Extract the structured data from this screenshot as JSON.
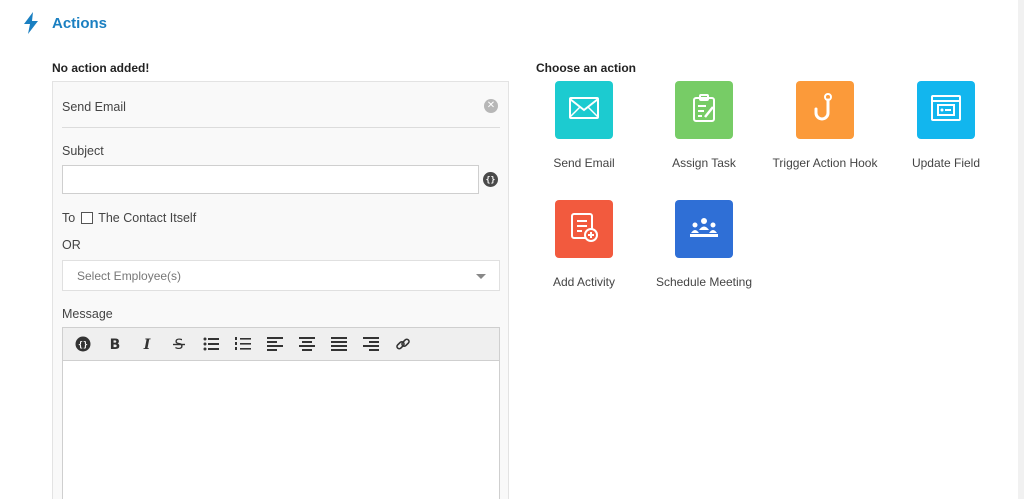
{
  "header": {
    "title": "Actions",
    "icon": "lightning-bolt-icon",
    "accent": "#1a7fc1"
  },
  "left": {
    "heading": "No action added!",
    "panel": {
      "title": "Send Email",
      "subject_label": "Subject",
      "subject_value": "",
      "to_label": "To",
      "to_option": "The Contact Itself",
      "or_label": "OR",
      "employee_placeholder": "Select Employee(s)",
      "message_label": "Message",
      "placeholder_glyph": "{}"
    }
  },
  "right": {
    "heading": "Choose an action",
    "actions": [
      {
        "label": "Send Email",
        "icon": "envelope-icon",
        "color": "#1ccbd0"
      },
      {
        "label": "Assign Task",
        "icon": "clipboard-task-icon",
        "color": "#77cc66"
      },
      {
        "label": "Trigger Action Hook",
        "icon": "hook-icon",
        "color": "#fb9a3a"
      },
      {
        "label": "Update Field",
        "icon": "form-field-icon",
        "color": "#12b6ee"
      },
      {
        "label": "Add Activity",
        "icon": "activity-list-icon",
        "color": "#f25a3e"
      },
      {
        "label": "Schedule Meeting",
        "icon": "meeting-icon",
        "color": "#2f6fd6"
      }
    ]
  }
}
